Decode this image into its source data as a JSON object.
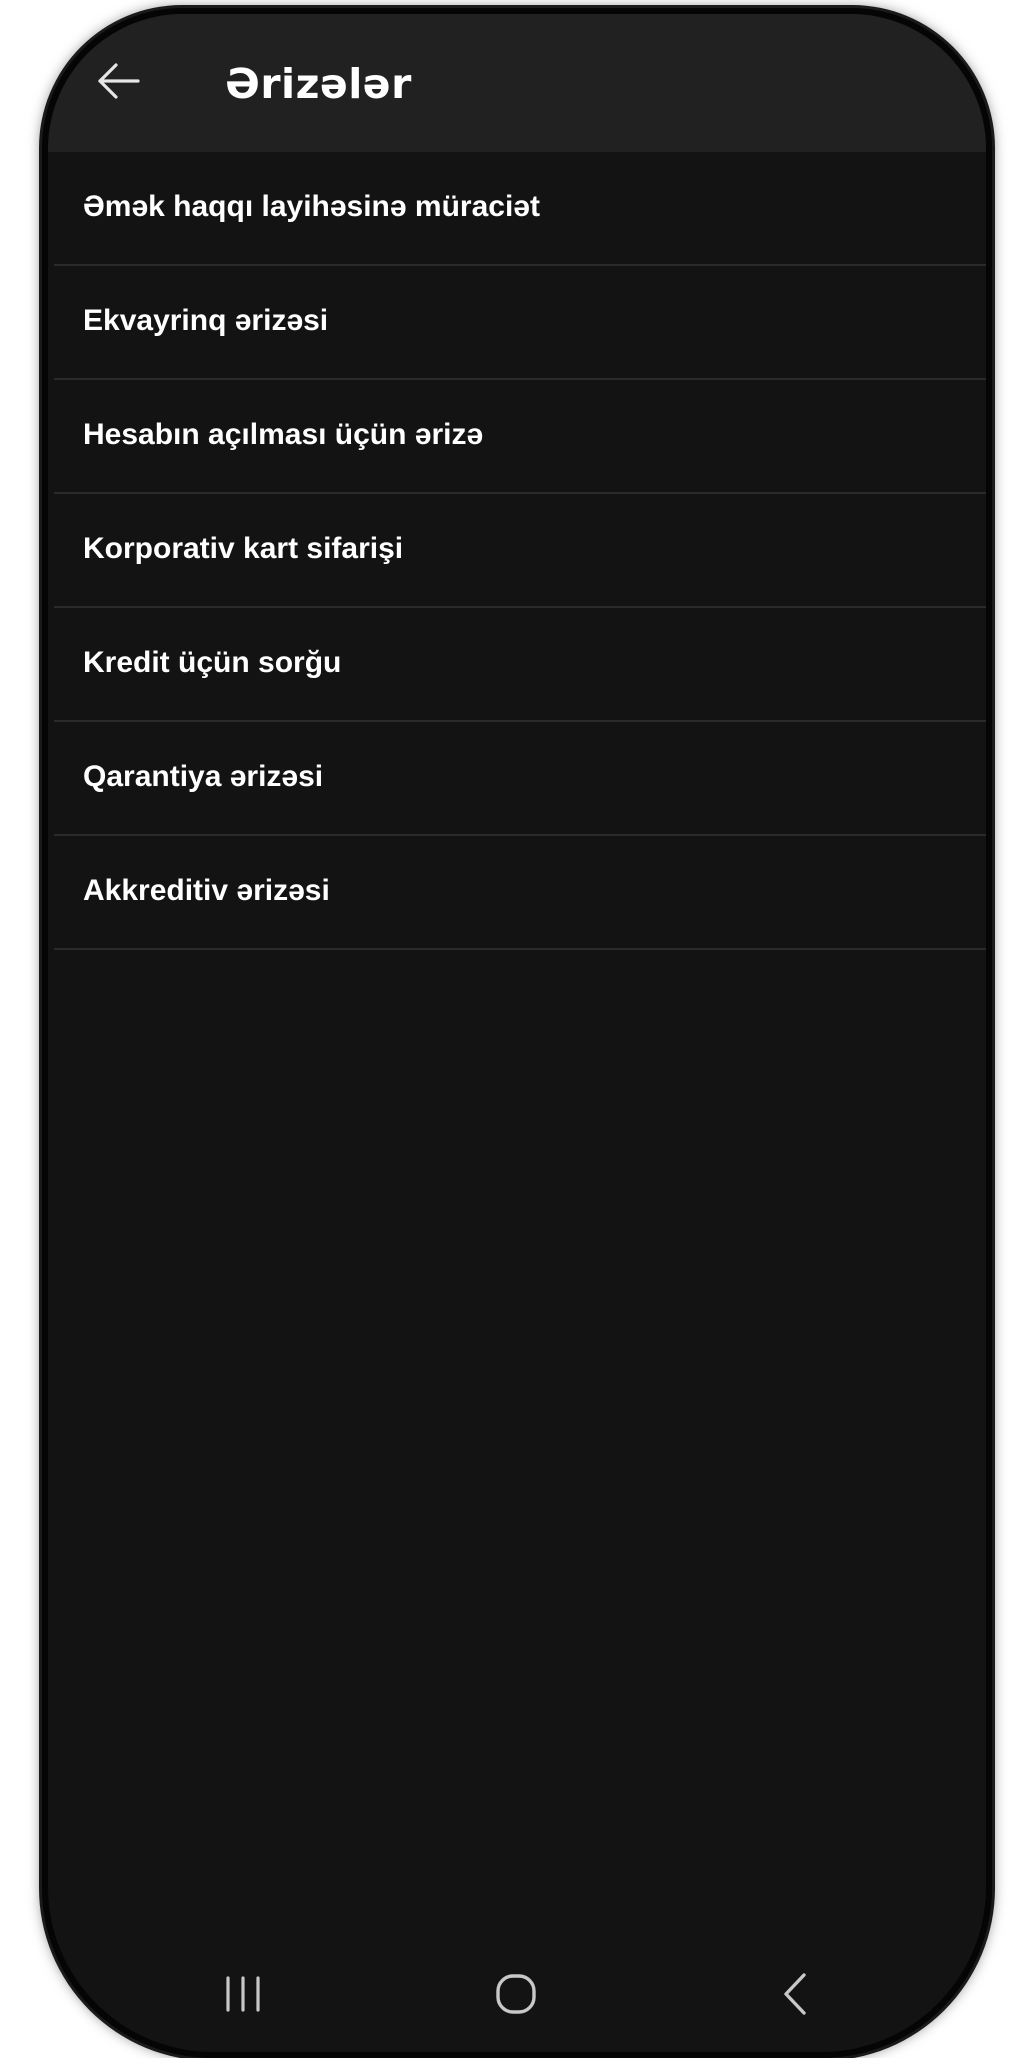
{
  "header": {
    "title": "Ərizələr",
    "back_icon": "arrow-left-icon"
  },
  "list": {
    "items": [
      {
        "label": "Əmək haqqı layihəsinə müraciət"
      },
      {
        "label": "Ekvayrinq ərizəsi"
      },
      {
        "label": "Hesabın açılması üçün ərizə"
      },
      {
        "label": "Korporativ kart sifarişi"
      },
      {
        "label": "Kredit üçün sorğu"
      },
      {
        "label": "Qarantiya ərizəsi"
      },
      {
        "label": "Akkreditiv ərizəsi"
      }
    ]
  },
  "nav_bar": {
    "recent_icon": "recent-apps-icon",
    "home_icon": "home-icon",
    "back_icon": "back-chevron-icon"
  },
  "colors": {
    "background": "#131313",
    "header_background": "#212121",
    "text": "#ffffff",
    "divider": "#2b2b2b",
    "nav_icon": "#c8c8c8"
  }
}
